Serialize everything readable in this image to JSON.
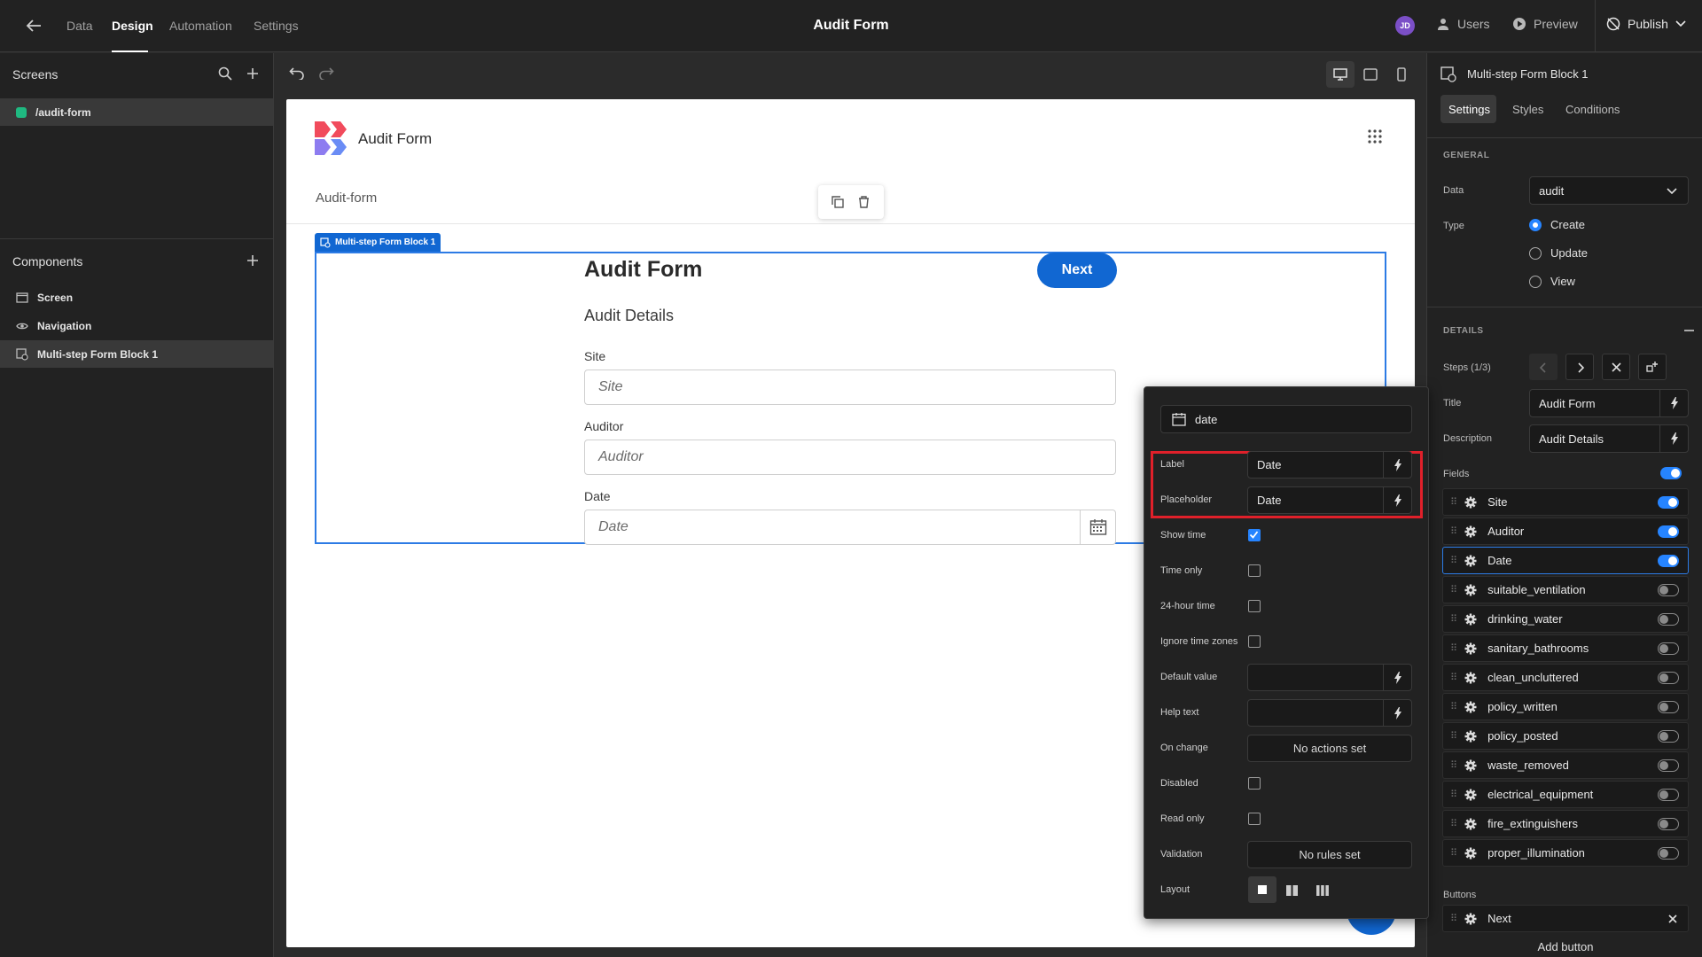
{
  "topbar": {
    "nav": [
      "Data",
      "Design",
      "Automation",
      "Settings"
    ],
    "title": "Audit Form",
    "avatar_initials": "JD",
    "users_label": "Users",
    "preview_label": "Preview",
    "publish_label": "Publish"
  },
  "left": {
    "screens_title": "Screens",
    "screen_route": "/audit-form",
    "components_title": "Components",
    "components": [
      "Screen",
      "Navigation",
      "Multi-step Form Block 1"
    ]
  },
  "canvas": {
    "app_name": "Audit Form",
    "page_heading": "Audit-form",
    "block_tag": "Multi-step Form Block 1",
    "form_title": "Audit Form",
    "form_description": "Audit Details",
    "next_button": "Next",
    "fields": [
      {
        "label": "Site",
        "placeholder": "Site"
      },
      {
        "label": "Auditor",
        "placeholder": "Auditor"
      },
      {
        "label": "Date",
        "placeholder": "Date"
      }
    ]
  },
  "popover": {
    "field_type": "date",
    "label_caption": "Label",
    "label_value": "Date",
    "placeholder_caption": "Placeholder",
    "placeholder_value": "Date",
    "show_time": "Show time",
    "time_only": "Time only",
    "hour24": "24-hour time",
    "ignore_tz": "Ignore time zones",
    "default_value": "Default value",
    "help_text": "Help text",
    "on_change": "On change",
    "on_change_value": "No actions set",
    "disabled": "Disabled",
    "read_only": "Read only",
    "validation": "Validation",
    "validation_value": "No rules set",
    "layout": "Layout",
    "highlight_color": "#e0202a"
  },
  "right": {
    "component_name": "Multi-step Form Block 1",
    "tabs": [
      "Settings",
      "Styles",
      "Conditions"
    ],
    "general_caption": "GENERAL",
    "data_label": "Data",
    "data_value": "audit",
    "type_label": "Type",
    "type_options": [
      "Create",
      "Update",
      "View"
    ],
    "details_caption": "DETAILS",
    "steps_label": "Steps (1/3)",
    "title_label": "Title",
    "title_value": "Audit Form",
    "description_label": "Description",
    "description_value": "Audit Details",
    "fields_label": "Fields",
    "fields": [
      {
        "name": "Site",
        "on": true
      },
      {
        "name": "Auditor",
        "on": true
      },
      {
        "name": "Date",
        "on": true
      },
      {
        "name": "suitable_ventilation",
        "on": false
      },
      {
        "name": "drinking_water",
        "on": false
      },
      {
        "name": "sanitary_bathrooms",
        "on": false
      },
      {
        "name": "clean_uncluttered",
        "on": false
      },
      {
        "name": "policy_written",
        "on": false
      },
      {
        "name": "policy_posted",
        "on": false
      },
      {
        "name": "waste_removed",
        "on": false
      },
      {
        "name": "electrical_equipment",
        "on": false
      },
      {
        "name": "fire_extinguishers",
        "on": false
      },
      {
        "name": "proper_illumination",
        "on": false
      }
    ],
    "buttons_label": "Buttons",
    "button_item": "Next",
    "add_button": "Add button"
  },
  "colors": {
    "accent": "#2684ff",
    "next_button": "#1167d2",
    "block_border": "#2c7be5"
  }
}
